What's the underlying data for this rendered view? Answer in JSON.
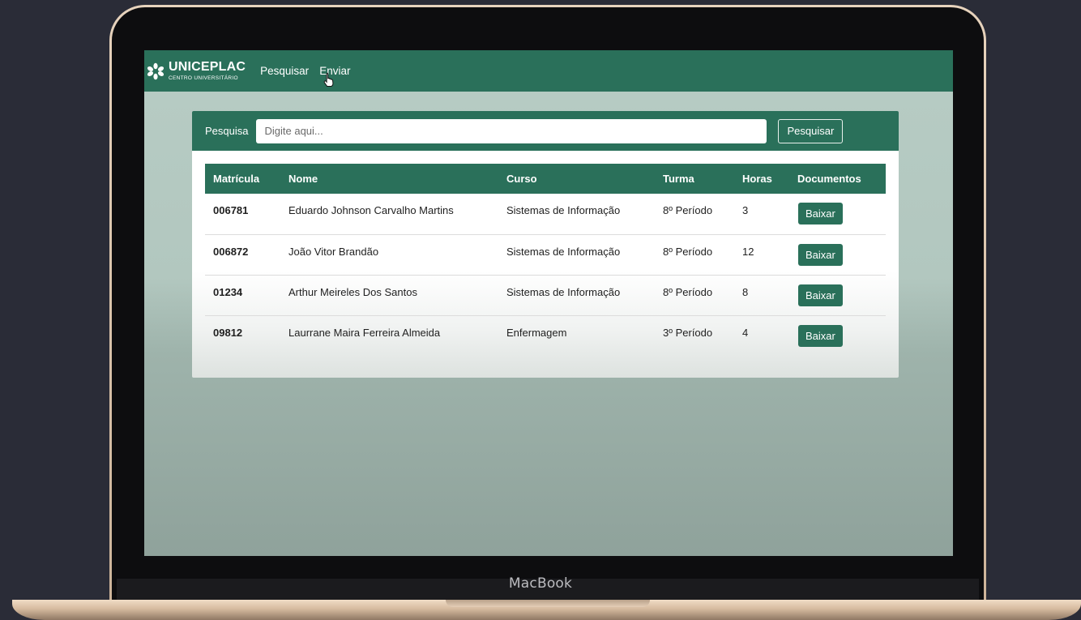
{
  "device": {
    "brand": "MacBook"
  },
  "app": {
    "logo": {
      "name": "UNICEPLAC",
      "subtitle": "CENTRO UNIVERSITÁRIO"
    },
    "nav": [
      {
        "label": "Pesquisar"
      },
      {
        "label": "Enviar"
      }
    ]
  },
  "search": {
    "label": "Pesquisa",
    "placeholder": "Digite aqui...",
    "value": "",
    "button_label": "Pesquisar"
  },
  "table": {
    "headers": [
      "Matrícula",
      "Nome",
      "Curso",
      "Turma",
      "Horas",
      "Documentos"
    ],
    "rows": [
      {
        "matricula": "006781",
        "nome": "Eduardo Johnson Carvalho Martins",
        "curso": "Sistemas de Informação",
        "turma": "8º Período",
        "horas": "3",
        "documento": "Baixar"
      },
      {
        "matricula": "006872",
        "nome": "João Vitor Brandão",
        "curso": "Sistemas de Informação",
        "turma": "8º Período",
        "horas": "12",
        "documento": "Baixar"
      },
      {
        "matricula": "01234",
        "nome": "Arthur Meireles Dos Santos",
        "curso": "Sistemas de Informação",
        "turma": "8º Período",
        "horas": "8",
        "documento": "Baixar"
      },
      {
        "matricula": "09812",
        "nome": "Laurrane Maira Ferreira Almeida",
        "curso": "Enfermagem",
        "turma": "3º Período",
        "horas": "4",
        "documento": "Baixar"
      }
    ]
  },
  "colors": {
    "primary": "#2a705a",
    "background": "#b7ccc4"
  },
  "icons": {
    "logo": "uniceplac-logo-icon",
    "cursor": "hand-pointer-icon"
  }
}
